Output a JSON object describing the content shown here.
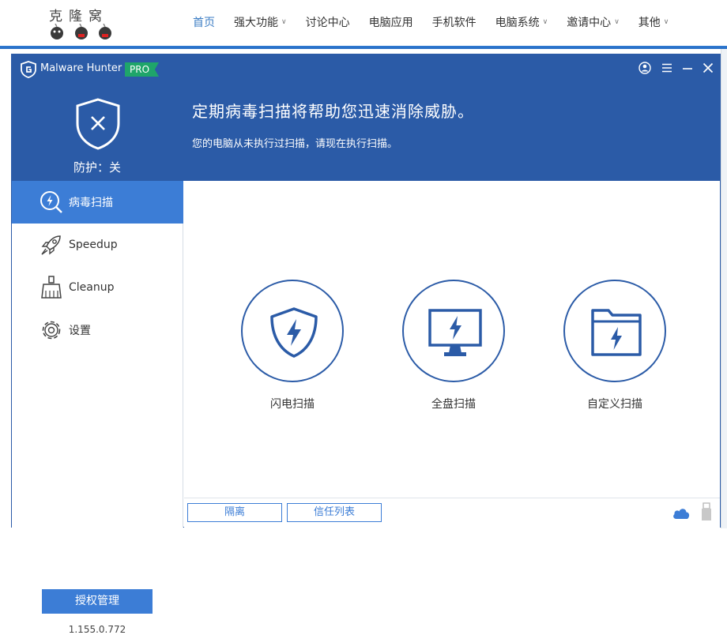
{
  "site": {
    "logo_text": "克隆窝",
    "nav": [
      {
        "label": "首页",
        "active": true,
        "dropdown": false
      },
      {
        "label": "强大功能",
        "active": false,
        "dropdown": true
      },
      {
        "label": "讨论中心",
        "active": false,
        "dropdown": false
      },
      {
        "label": "电脑应用",
        "active": false,
        "dropdown": false
      },
      {
        "label": "手机软件",
        "active": false,
        "dropdown": false
      },
      {
        "label": "电脑系统",
        "active": false,
        "dropdown": true
      },
      {
        "label": "邀请中心",
        "active": false,
        "dropdown": true
      },
      {
        "label": "其他",
        "active": false,
        "dropdown": true
      }
    ],
    "accent_color": "#3c7dc4"
  },
  "app": {
    "name": "Malware Hunter",
    "badge": "PRO",
    "window_controls": [
      "account-icon",
      "menu-icon",
      "minimize-icon",
      "close-icon"
    ],
    "protection_status": "防护：关",
    "headline": "定期病毒扫描将帮助您迅速消除威胁。",
    "subline": "您的电脑从未执行过扫描，请现在执行扫描。",
    "colors": {
      "header": "#2b5ba7",
      "active": "#3c7dd6",
      "badge": "#1fa56a"
    }
  },
  "sidebar": {
    "items": [
      {
        "label": "病毒扫描",
        "icon": "virus-scan-icon",
        "active": true
      },
      {
        "label": "Speedup",
        "icon": "rocket-icon",
        "active": false
      },
      {
        "label": "Cleanup",
        "icon": "broom-icon",
        "active": false
      },
      {
        "label": "设置",
        "icon": "gear-icon",
        "active": false
      }
    ],
    "license_button": "授权管理",
    "version": "1.155.0.772"
  },
  "main": {
    "scan_options": [
      {
        "label": "闪电扫描",
        "icon": "lightning-shield-icon"
      },
      {
        "label": "全盘扫描",
        "icon": "monitor-lightning-icon"
      },
      {
        "label": "自定义扫描",
        "icon": "folder-lightning-icon"
      }
    ],
    "bottom": {
      "quarantine": "隔离",
      "trust_list": "信任列表"
    }
  }
}
